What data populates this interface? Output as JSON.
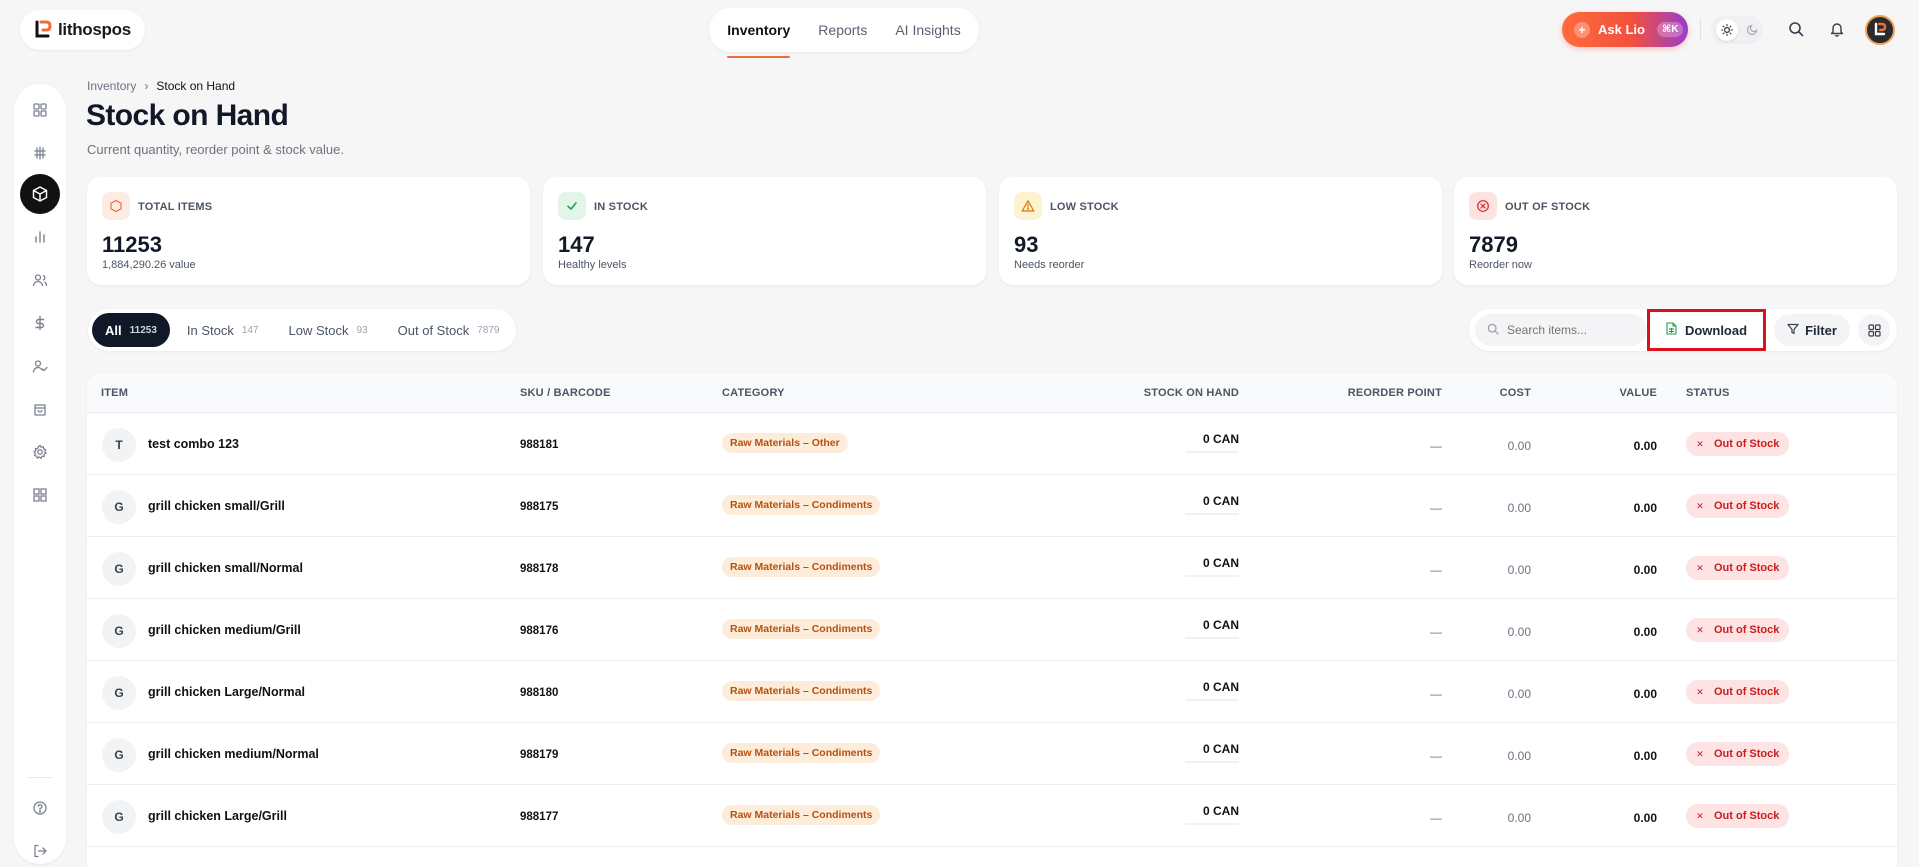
{
  "brand": {
    "name": "lithospos"
  },
  "topnav": {
    "tabs": [
      {
        "label": "Inventory"
      },
      {
        "label": "Reports"
      },
      {
        "label": "AI Insights"
      }
    ]
  },
  "header": {
    "ask_label": "Ask Lio",
    "ask_shortcut": "⌘K"
  },
  "breadcrumb": {
    "parent": "Inventory",
    "separator": "›",
    "current": "Stock on Hand"
  },
  "page": {
    "title": "Stock on Hand",
    "subtitle": "Current quantity, reorder point & stock value."
  },
  "stats": [
    {
      "label": "TOTAL ITEMS",
      "value": "11253",
      "sub": "1,884,290.26 value",
      "icon": "box-icon",
      "color": "#f26b3a"
    },
    {
      "label": "IN STOCK",
      "value": "147",
      "sub": "Healthy levels",
      "icon": "check-icon",
      "color": "#16a34a"
    },
    {
      "label": "LOW STOCK",
      "value": "93",
      "sub": "Needs reorder",
      "icon": "warning-icon",
      "color": "#d97706"
    },
    {
      "label": "OUT OF STOCK",
      "value": "7879",
      "sub": "Reorder now",
      "icon": "x-circle-icon",
      "color": "#dc2626"
    }
  ],
  "filters": [
    {
      "label": "All",
      "count": "11253"
    },
    {
      "label": "In Stock",
      "count": "147"
    },
    {
      "label": "Low Stock",
      "count": "93"
    },
    {
      "label": "Out of Stock",
      "count": "7879"
    }
  ],
  "tools": {
    "search_placeholder": "Search items...",
    "download_label": "Download",
    "filter_label": "Filter"
  },
  "table": {
    "columns": {
      "item": "ITEM",
      "sku": "SKU / BARCODE",
      "category": "CATEGORY",
      "stock": "STOCK ON HAND",
      "reorder": "REORDER POINT",
      "cost": "COST",
      "value": "VALUE",
      "status": "STATUS"
    },
    "rows": [
      {
        "initial": "T",
        "name": "test combo 123",
        "sku": "988181",
        "category": "Raw Materials – Other",
        "stock": "0 CAN",
        "reorder": "—",
        "cost": "0.00",
        "value": "0.00",
        "status": "Out of Stock"
      },
      {
        "initial": "G",
        "name": "grill chicken small/Grill",
        "sku": "988175",
        "category": "Raw Materials – Condiments",
        "stock": "0 CAN",
        "reorder": "—",
        "cost": "0.00",
        "value": "0.00",
        "status": "Out of Stock"
      },
      {
        "initial": "G",
        "name": "grill chicken small/Normal",
        "sku": "988178",
        "category": "Raw Materials – Condiments",
        "stock": "0 CAN",
        "reorder": "—",
        "cost": "0.00",
        "value": "0.00",
        "status": "Out of Stock"
      },
      {
        "initial": "G",
        "name": "grill chicken medium/Grill",
        "sku": "988176",
        "category": "Raw Materials – Condiments",
        "stock": "0 CAN",
        "reorder": "—",
        "cost": "0.00",
        "value": "0.00",
        "status": "Out of Stock"
      },
      {
        "initial": "G",
        "name": "grill chicken Large/Normal",
        "sku": "988180",
        "category": "Raw Materials – Condiments",
        "stock": "0 CAN",
        "reorder": "—",
        "cost": "0.00",
        "value": "0.00",
        "status": "Out of Stock"
      },
      {
        "initial": "G",
        "name": "grill chicken medium/Normal",
        "sku": "988179",
        "category": "Raw Materials – Condiments",
        "stock": "0 CAN",
        "reorder": "—",
        "cost": "0.00",
        "value": "0.00",
        "status": "Out of Stock"
      },
      {
        "initial": "G",
        "name": "grill chicken Large/Grill",
        "sku": "988177",
        "category": "Raw Materials – Condiments",
        "stock": "0 CAN",
        "reorder": "—",
        "cost": "0.00",
        "value": "0.00",
        "status": "Out of Stock"
      }
    ]
  },
  "colors": {
    "accent": "#f26b3a",
    "status_out": "#c81e1e",
    "category_badge": "#fdecd9",
    "highlight": "#d6131f"
  }
}
